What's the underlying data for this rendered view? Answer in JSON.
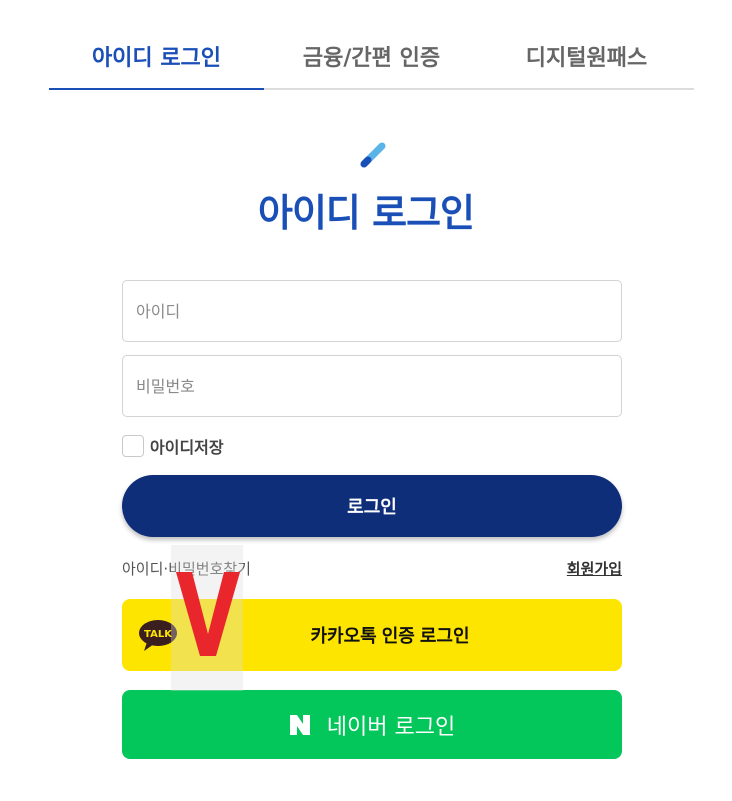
{
  "tabs": [
    {
      "label": "아이디 로그인",
      "active": true
    },
    {
      "label": "금융/간편 인증",
      "active": false
    },
    {
      "label": "디지털원패스",
      "active": false
    }
  ],
  "header": {
    "title": "아이디 로그인",
    "icon": "pen-icon"
  },
  "form": {
    "id_placeholder": "아이디",
    "id_value": "",
    "pw_placeholder": "비밀번호",
    "pw_value": "",
    "remember_label": "아이디저장",
    "remember_checked": false,
    "login_label": "로그인"
  },
  "links": {
    "find": "아이디·비밀번호찾기",
    "signup": "회원가입"
  },
  "social": {
    "kakao_label": "카카오톡 인증 로그인",
    "kakao_icon_text": "TALK",
    "naver_label": "네이버 로그인"
  },
  "annotation": {
    "mark": "V",
    "color": "#e8262b"
  },
  "colors": {
    "primary": "#1a4fb8",
    "login_button": "#0f2e7a",
    "kakao": "#fee500",
    "naver": "#03c75a"
  }
}
